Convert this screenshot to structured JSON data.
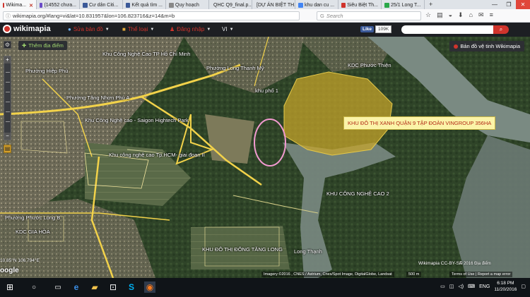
{
  "browser": {
    "tabs": [
      {
        "label": "Wikima...",
        "color": "#d0342c",
        "active": true
      },
      {
        "label": "(14552 chưa...",
        "color": "#6b4cc8"
      },
      {
        "label": "Cư dân Citi...",
        "color": "#3b5998"
      },
      {
        "label": "Kết quả tìm ...",
        "color": "#3b5998"
      },
      {
        "label": "Quy hoạch",
        "color": "#888888"
      },
      {
        "label": "QHC Q9_final.p...",
        "color": "#888888"
      },
      {
        "label": "[DỰ ÁN BIỆT TH...",
        "color": "#d0342c"
      },
      {
        "label": "khu dan cu ...",
        "color": "#4285f4"
      },
      {
        "label": "Siêu Biệt Th...",
        "color": "#d0342c"
      },
      {
        "label": "25/1 Long T...",
        "color": "#2ba84a"
      }
    ],
    "new_tab": "+",
    "url": "wikimapia.org/#lang=vi&lat=10.831957&lon=106.823716&z=14&m=b",
    "search_placeholder": "Search",
    "window_controls": {
      "minimize": "—",
      "maximize": "❐",
      "close": "✕"
    }
  },
  "wikimapia": {
    "logo": "wikimapia",
    "menu": [
      {
        "label": "Sửa bản đồ",
        "icon": "globe-icon"
      },
      {
        "label": "Thể loại",
        "icon": "folder-icon"
      },
      {
        "label": "Đăng nhập",
        "icon": "user-icon"
      },
      {
        "label": "VI"
      }
    ],
    "fb_like": "Like",
    "fb_count": "109K",
    "search_button_icon": "search-icon"
  },
  "map": {
    "add_place_button": "Thêm địa điểm",
    "satellite_button": "Bản đồ vệ tinh Wikimapia",
    "callout": "KHU ĐÔ THỊ XANH QUẬN 9 TẬP ĐOÀN VINGROUP 356HA",
    "labels": [
      {
        "text": "Khu Công Nghệ Cao TP Hồ Chí Minh"
      },
      {
        "text": "Phường Hiệp Phú"
      },
      {
        "text": "Phường Long Thạnh Mỹ"
      },
      {
        "text": "KDC Phước Thiện"
      },
      {
        "text": "khu phố 1"
      },
      {
        "text": "Phường Tăng Nhơn Phú A"
      },
      {
        "text": "Khu Công Nghệ cao - Saigon Hightech Park"
      },
      {
        "text": "Khu công nghệ cao Tp.HCM- giai đoạn II"
      },
      {
        "text": "KHU CÔNG NGHỆ CAO 2"
      },
      {
        "text": "Phường Phước Long B"
      },
      {
        "text": "KDC GIA HÒA"
      },
      {
        "text": "KHU ĐÔ THỊ ĐÔNG TĂNG LONG"
      },
      {
        "text": "Long Thạnh"
      }
    ],
    "coords": "10.85°N 106.794°E",
    "google": "oogle",
    "cc": "Wikimapia CC-BY-SA",
    "copyright": "© 2016 Địa điểm",
    "attribution": "Imagery ©2016 , CNES / Astrium, Cnes/Spot Image, DigitalGlobe, Landsat",
    "scale": "500 m",
    "terms": "Terms of Use | Report a map error"
  },
  "taskbar": {
    "lang": "ENG",
    "time": "6:18 PM",
    "date": "11/20/2016"
  },
  "colors": {
    "project_zone": "#c9a62a",
    "river": "#7a8a82",
    "wikimapia_red": "#d0342c",
    "road": "#f2d24a",
    "callout_bg": "#fbf4a8"
  }
}
